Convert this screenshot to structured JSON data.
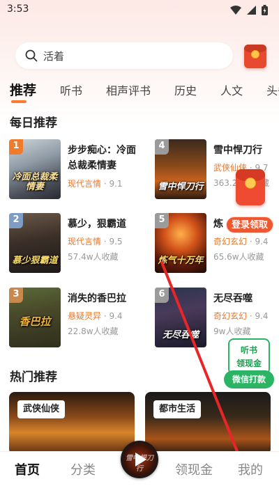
{
  "status_bar": {
    "time": "3:53"
  },
  "search": {
    "placeholder": "活着"
  },
  "tabs": [
    {
      "label": "推荐"
    },
    {
      "label": "听书"
    },
    {
      "label": "相声评书"
    },
    {
      "label": "历史"
    },
    {
      "label": "人文"
    },
    {
      "label": "头条"
    }
  ],
  "daily": {
    "title": "每日推荐",
    "books": [
      {
        "rank": "1",
        "title": "步步痴心：冷面总裁柔情妻",
        "genre": "现代言情",
        "stat": "9.1",
        "cover_text": "冷面总裁柔情妻"
      },
      {
        "rank": "2",
        "title": "慕少，狠霸道",
        "genre": "现代言情",
        "stat": "9.5",
        "collect": "57.4w人收藏",
        "cover_text": "慕少狠霸道"
      },
      {
        "rank": "3",
        "title": "消失的香巴拉",
        "genre": "悬疑灵异",
        "stat": "9.4",
        "collect": "22.8w人收藏",
        "cover_text": "香巴拉"
      },
      {
        "rank": "4",
        "title": "雪中悍刀行",
        "genre": "武侠仙侠",
        "stat": "9.7",
        "collect": "363.2w人收藏",
        "cover_text": "雪中悍刀行"
      },
      {
        "rank": "5",
        "title": "炼气十万年",
        "title_short": "炼",
        "genre": "奇幻玄幻",
        "stat": "9.4",
        "collect": "65.6w人收藏",
        "cover_text": "炼气十万年"
      },
      {
        "rank": "6",
        "title": "无尽吞噬",
        "genre": "奇幻玄幻",
        "stat": "9.4",
        "collect": "9w人收藏",
        "cover_text": "无尽吞噬"
      }
    ]
  },
  "float_redpack": {
    "label": "登录领取"
  },
  "float_cash": {
    "line1": "听书",
    "line2": "领现金",
    "button": "微信打款"
  },
  "hot": {
    "title": "热门推荐",
    "cards": [
      {
        "tag": "武侠仙侠"
      },
      {
        "tag": "都市生活"
      }
    ]
  },
  "bottom_nav": {
    "items": [
      {
        "label": "首页"
      },
      {
        "label": "分类"
      },
      {
        "label": "领现金"
      },
      {
        "label": "我的"
      }
    ],
    "player_text": "雪中悍刀行"
  },
  "colors": {
    "accent": "#ff7a2d",
    "genre": "#e8782c",
    "red": "#ef4b32",
    "green": "#2ab463"
  }
}
